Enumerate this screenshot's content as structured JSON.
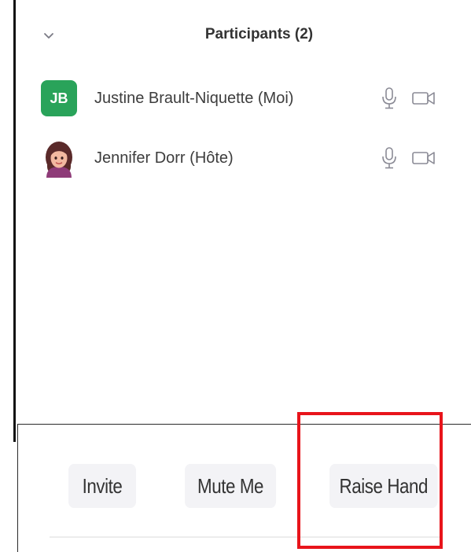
{
  "panel": {
    "title": "Participants (2)",
    "collapse_icon": "chevron-down-icon"
  },
  "participants": [
    {
      "name": "Justine Brault-Niquette (Moi)",
      "initials": "JB",
      "avatar_color": "#29a35a",
      "avatar_type": "initials",
      "mic_icon": "microphone-icon",
      "video_icon": "video-camera-icon"
    },
    {
      "name": "Jennifer Dorr (Hôte)",
      "initials": "",
      "avatar_type": "photo",
      "mic_icon": "microphone-icon",
      "video_icon": "video-camera-icon"
    }
  ],
  "footer": {
    "invite_label": "Invite",
    "mute_label": "Mute Me",
    "raise_hand_label": "Raise Hand"
  },
  "annotation": {
    "highlight_color": "#e8141b"
  }
}
